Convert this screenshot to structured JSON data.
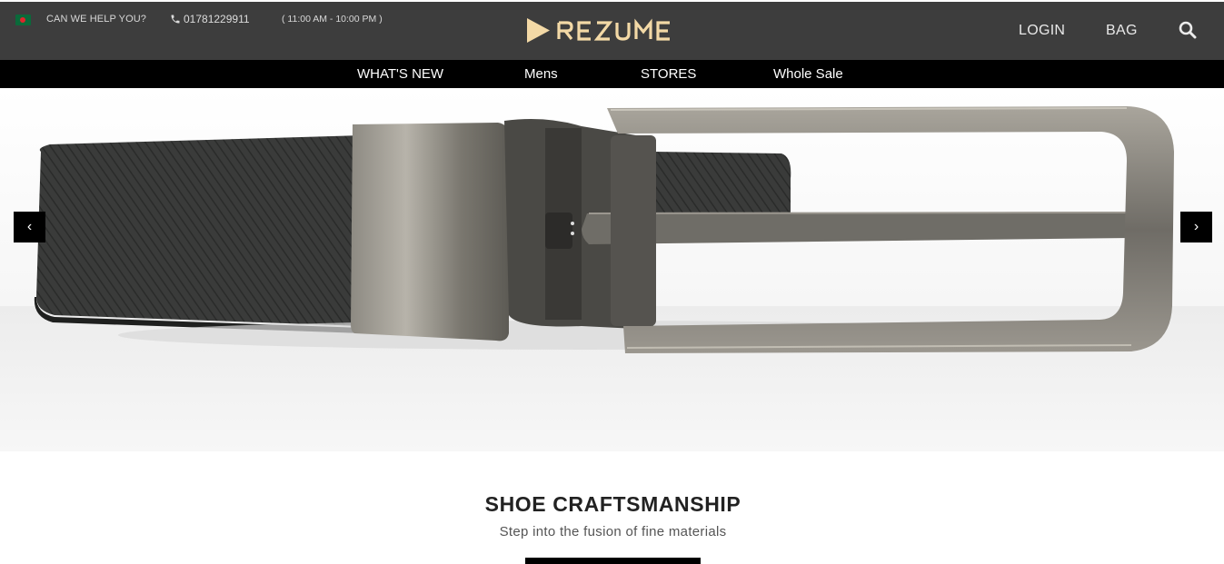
{
  "topbar": {
    "help_text": "CAN WE HELP YOU?",
    "phone": "01781229911",
    "hours": "( 11:00 AM - 10:00 PM )",
    "login_label": "LOGIN",
    "bag_label": "BAG",
    "brand": "REZUME",
    "icons": [
      "flag-icon",
      "phone-icon",
      "search-icon"
    ]
  },
  "nav": {
    "items": [
      {
        "label": "WHAT'S NEW"
      },
      {
        "label": "Mens"
      },
      {
        "label": "STORES"
      },
      {
        "label": "Whole Sale"
      }
    ]
  },
  "hero": {
    "prev_label": "‹",
    "next_label": "›"
  },
  "section": {
    "title": "SHOE CRAFTSMANSHIP",
    "subtitle": "Step into the fusion of fine materials"
  },
  "colors": {
    "header_bg": "#3d3d3d",
    "nav_bg": "#000000",
    "logo_accent": "#f3d9a6"
  }
}
